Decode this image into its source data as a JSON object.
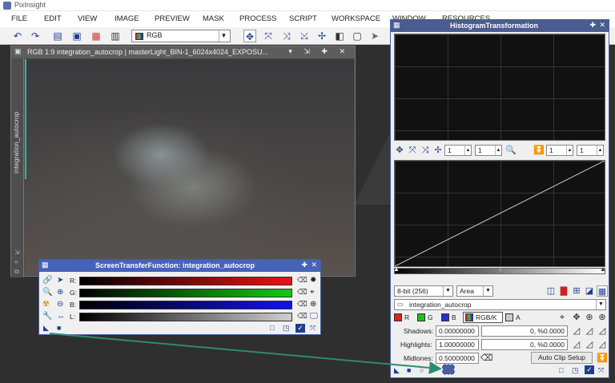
{
  "app": {
    "title": "PixInsight"
  },
  "menu": [
    "FILE",
    "EDIT",
    "VIEW",
    "IMAGE",
    "PREVIEW",
    "MASK",
    "PROCESS",
    "SCRIPT",
    "WORKSPACE",
    "WINDOW",
    "RESOURCES"
  ],
  "toolbar": {
    "channel_select": "RGB"
  },
  "image_window": {
    "title": "RGB 1:9 integration_autocrop | masterLight_BIN-1_6024x4024_EXPOSU...",
    "side_label": "integration_autocrop"
  },
  "stf": {
    "title": "ScreenTransferFunction: integration_autocrop",
    "channels": [
      {
        "label": "R:",
        "color": "#ee1111"
      },
      {
        "label": "G:",
        "color": "#11cc11"
      },
      {
        "label": "B:",
        "color": "#1111ee"
      },
      {
        "label": "L:",
        "color": "#cfcfcf"
      }
    ]
  },
  "histogram": {
    "title": "HistogramTransformation",
    "zoom_values": [
      "1",
      "1",
      "1",
      "1"
    ],
    "bit_depth": "8-bit (256)",
    "plot_mode": "Area",
    "view_select": "integration_autocrop",
    "channels": [
      {
        "label": "R",
        "color": "#dd2222"
      },
      {
        "label": "G",
        "color": "#22bb22"
      },
      {
        "label": "B",
        "color": "#2233cc"
      },
      {
        "label": "RGB/K",
        "color": "#666666"
      },
      {
        "label": "A",
        "color": "#cccccc"
      }
    ],
    "shadows_label": "Shadows:",
    "shadows_value": "0.00000000",
    "shadows_clip": "0, %0.0000",
    "highlights_label": "Highlights:",
    "highlights_value": "1.00000000",
    "highlights_clip": "0, %0.0000",
    "midtones_label": "Midtones:",
    "midtones_value": "0.50000000",
    "auto_clip_label": "Auto Clip Setup"
  }
}
